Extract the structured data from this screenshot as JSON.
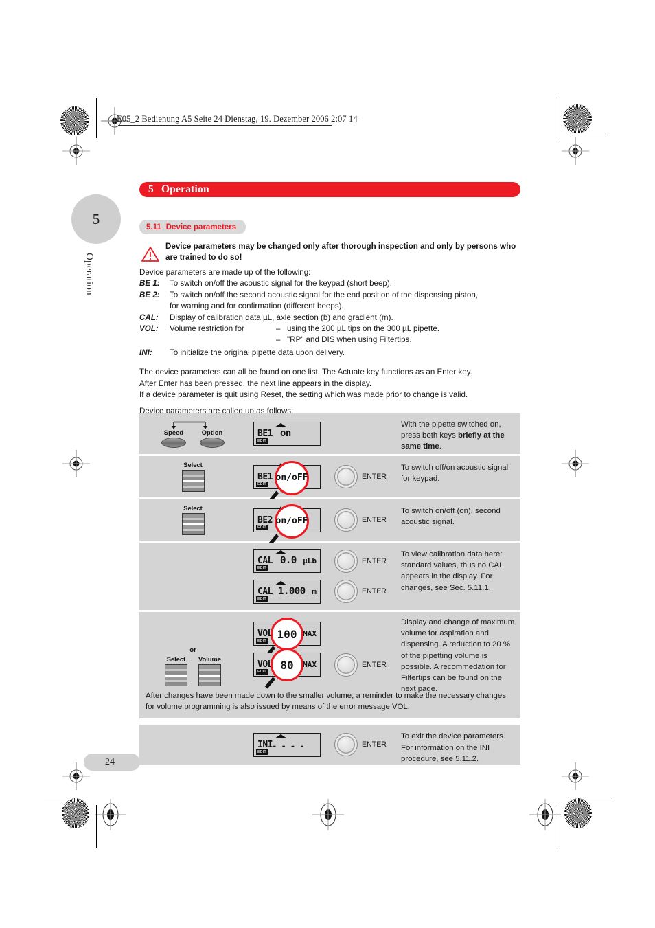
{
  "imprint": {
    "line": "E05_2 Bedienung A5  Seite 24  Dienstag, 19. Dezember 2006  2:07 14"
  },
  "margin": {
    "chapter_number": "5",
    "chapter_vertical_label": "Operation",
    "page_number": "24"
  },
  "banner": {
    "number": "5",
    "title": "Operation"
  },
  "section": {
    "number": "5.11",
    "title": "Device parameters"
  },
  "warning": {
    "icon": "warning-triangle-icon",
    "text": "Device parameters may be changed only after thorough inspection and only by persons who are trained to do so!"
  },
  "intro": {
    "lead": "Device parameters are made up of the following:",
    "definitions": [
      {
        "key": "BE 1:",
        "value": "To switch on/off the acoustic signal for the keypad (short beep)."
      },
      {
        "key": "BE 2:",
        "value": "To switch on/off the second acoustic signal for the end position of the dispensing piston,",
        "cont": "for warning and for confirmation (different beeps)."
      },
      {
        "key": "CAL:",
        "value": "Display of calibration data µL, axle section (b) and gradient (m)."
      }
    ],
    "vol": {
      "key": "VOL:",
      "lead": "Volume restriction for",
      "dash": "–",
      "item1": "using the 200 µL tips on the 300 µL pipette.",
      "item2": "\"RP\" and DIS when using Filtertips."
    },
    "ini": {
      "key": "INI:",
      "value": "To initialize the original pipette data upon delivery."
    },
    "paragraph1_line1": "The device parameters can all be found on one list. The Actuate key functions as an Enter key.",
    "paragraph1_line2": "After Enter has been pressed, the next line appears in the display.",
    "paragraph1_line3": "If a device parameter is quit using Reset, the setting which was made prior to change is valid.",
    "paragraph2": "Device parameters are called up as follows:"
  },
  "table": {
    "rows": [
      {
        "keys": {
          "type": "oval-pair",
          "left_label": "Speed",
          "right_label": "Option"
        },
        "displays": [
          {
            "seg": "BE1",
            "value": "on",
            "unit": "",
            "triangle": true,
            "edit_tag": "EDIT",
            "magnified": null
          }
        ],
        "enter": [],
        "desc_parts": [
          {
            "text": "With the pipette switched on, press both keys ",
            "bold": false
          },
          {
            "text": "briefly at the same time",
            "bold": true
          },
          {
            "text": ".",
            "bold": false
          }
        ]
      },
      {
        "keys": {
          "type": "slider-one",
          "label": "Select"
        },
        "displays": [
          {
            "seg": "BE1",
            "value": "",
            "unit": "",
            "triangle": false,
            "edit_tag": "EDIT",
            "magnified": "on/oFF"
          }
        ],
        "enter": [
          "ENTER"
        ],
        "desc_parts": [
          {
            "text": "To switch off/on acoustic signal for keypad.",
            "bold": false
          }
        ]
      },
      {
        "keys": {
          "type": "slider-one",
          "label": "Select"
        },
        "displays": [
          {
            "seg": "BE2",
            "value": "",
            "unit": "",
            "triangle": false,
            "edit_tag": "EDIT",
            "magnified": "on/oFF"
          }
        ],
        "enter": [
          "ENTER"
        ],
        "desc_parts": [
          {
            "text": "To switch on/off (on), second acoustic signal.",
            "bold": false
          }
        ]
      },
      {
        "keys": {
          "type": "none"
        },
        "displays": [
          {
            "seg": "CAL",
            "value": "0.0",
            "unit": "µLb",
            "triangle": true,
            "edit_tag": "EDIT",
            "magnified": null
          },
          {
            "seg": "CAL",
            "value": "1.000",
            "unit": "m",
            "triangle": true,
            "edit_tag": "EDIT",
            "magnified": null
          }
        ],
        "enter": [
          "ENTER",
          "ENTER"
        ],
        "desc_parts": [
          {
            "text": "To view calibration data here: standard values, thus no CAL appears in the display. For changes, see Sec. 5.11.1.",
            "bold": false
          }
        ]
      },
      {
        "keys": {
          "type": "slider-two",
          "or_label": "or",
          "label1": "Select",
          "label2": "Volume"
        },
        "displays": [
          {
            "seg": "VOL",
            "value": "",
            "unit": "µMAX",
            "triangle": false,
            "edit_tag": "EDIT",
            "magnified": "100"
          },
          {
            "seg": "VOL",
            "value": "",
            "unit": "µMAX",
            "triangle": false,
            "edit_tag": "EDIT",
            "magnified": "80"
          }
        ],
        "enter": [
          "ENTER"
        ],
        "desc_parts": [
          {
            "text": "Display and change of maximum volume for aspiration and dispensing. A reduction to 20 % of the pipetting volume is possible. A recommedation for Filtertips can be found on the next page.",
            "bold": false
          }
        ]
      }
    ],
    "note": "After changes have been made down to the smaller volume, a reminder to make the necessary changes for volume programming is also issued by means of the error message VOL.",
    "final_row": {
      "display": {
        "seg": "INI",
        "value": "- - - -",
        "unit": "",
        "triangle": true,
        "edit_tag": "EDIT",
        "magnified": null
      },
      "enter": "ENTER",
      "desc": "To exit the device parameters. For information on the INI procedure, see 5.11.2."
    }
  },
  "colors": {
    "brand_red": "#ec1b24",
    "panel_gray": "#d4d4d4",
    "pill_gray": "#d9d9d9",
    "lcd_gray": "#d0d0d0"
  }
}
